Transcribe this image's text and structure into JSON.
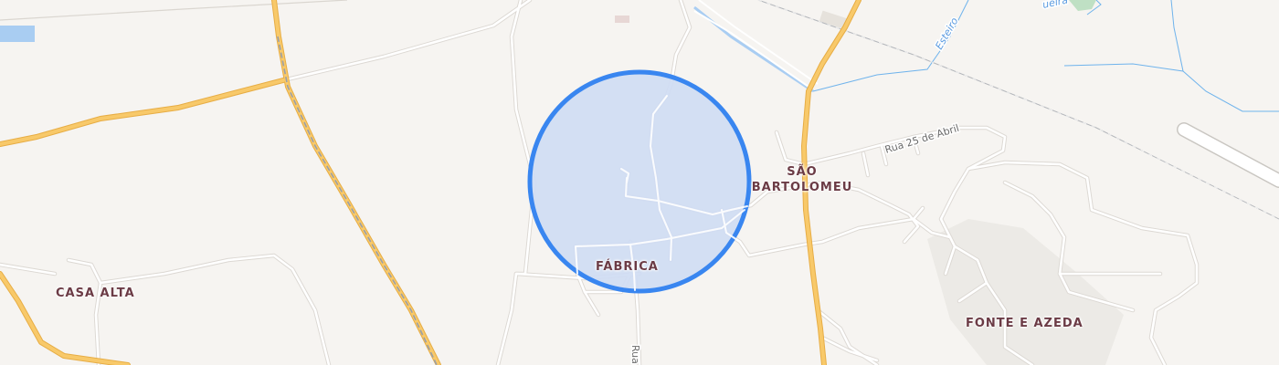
{
  "map": {
    "colors": {
      "background": "#f6f4f1",
      "minor_road": "#ffffff",
      "minor_road_casing": "#dcd8d3",
      "major_road": "#f8c96a",
      "major_road_casing": "#e7ad45",
      "railway": "#9a9fa8",
      "waterway": "#6fb3ec",
      "water": "#a9cdf2",
      "area_highlight_fill": "#cfdcf3",
      "area_highlight_stroke": "#3986f0",
      "place_label": "#6b3b45",
      "street_label": "#6b6b6b",
      "water_label": "#5b9be0"
    },
    "places": {
      "casa_alta": "CASA ALTA",
      "fabrica": "FÁBRICA",
      "sao_bartolomeu_line1": "SÃO",
      "sao_bartolomeu_line2": "BARTOLOMEU",
      "fonte_e_azeda": "FONTE E AZEDA"
    },
    "streets": {
      "rua_25_de_abril": "Rua 25 de Abril",
      "rua_partial": "Rua"
    },
    "waterways": {
      "esteiro": "Esteiro",
      "partial": "ueira"
    }
  }
}
